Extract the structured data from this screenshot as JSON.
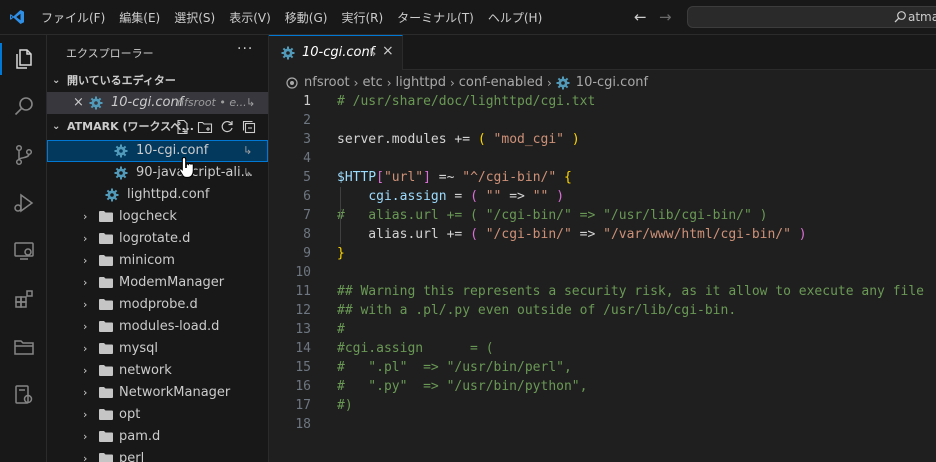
{
  "menubar": {
    "items": [
      "ファイル(F)",
      "編集(E)",
      "選択(S)",
      "表示(V)",
      "移動(G)",
      "実行(R)",
      "ターミナル(T)",
      "ヘルプ(H)"
    ]
  },
  "nav": {
    "back": "←",
    "forward": "→"
  },
  "command_center": {
    "text": "atma"
  },
  "colors": {
    "accent": "#0078d4",
    "selection": "#04395e",
    "gear": "#519aba",
    "folder": "#c5c5c5"
  },
  "sidebar": {
    "title": "エクスプローラー",
    "more": "···",
    "open_editors": {
      "header": "開いているエディター",
      "items": [
        {
          "name": "10-cgi.conf",
          "desc": "nfsroot • e..."
        }
      ]
    },
    "workspace": {
      "header": "ATMARK (ワークスペ...",
      "tree": [
        {
          "name": "10-cgi.conf",
          "type": "conf"
        },
        {
          "name": "90-javascript-ali...",
          "type": "conf"
        },
        {
          "name": "lighttpd.conf",
          "type": "conf"
        },
        {
          "name": "logcheck",
          "type": "folder"
        },
        {
          "name": "logrotate.d",
          "type": "folder"
        },
        {
          "name": "minicom",
          "type": "folder"
        },
        {
          "name": "ModemManager",
          "type": "folder"
        },
        {
          "name": "modprobe.d",
          "type": "folder"
        },
        {
          "name": "modules-load.d",
          "type": "folder"
        },
        {
          "name": "mysql",
          "type": "folder"
        },
        {
          "name": "network",
          "type": "folder"
        },
        {
          "name": "NetworkManager",
          "type": "folder"
        },
        {
          "name": "opt",
          "type": "folder"
        },
        {
          "name": "pam.d",
          "type": "folder"
        },
        {
          "name": "perl",
          "type": "folder"
        }
      ]
    }
  },
  "editor": {
    "tab": {
      "label": "10-cgi.conf",
      "close": "×",
      "link": "↳"
    },
    "breadcrumb": [
      "nfsroot",
      "etc",
      "lighttpd",
      "conf-enabled",
      "10-cgi.conf"
    ],
    "lines": [
      [
        [
          "c-com",
          "# /usr/share/doc/lighttpd/cgi.txt"
        ]
      ],
      [],
      [
        [
          "c-txt",
          "server.modules += "
        ],
        [
          "c-br1",
          "("
        ],
        [
          "c-txt",
          " "
        ],
        [
          "c-str",
          "\"mod_cgi\""
        ],
        [
          "c-txt",
          " "
        ],
        [
          "c-br1",
          ")"
        ]
      ],
      [],
      [
        [
          "c-var",
          "$HTTP"
        ],
        [
          "c-br2",
          "["
        ],
        [
          "c-str",
          "\"url\""
        ],
        [
          "c-br2",
          "]"
        ],
        [
          "c-txt",
          " =~ "
        ],
        [
          "c-str",
          "\"^/cgi-bin/\""
        ],
        [
          "c-txt",
          " "
        ],
        [
          "c-br1",
          "{"
        ]
      ],
      [
        [
          "c-txt",
          "    "
        ],
        [
          "c-var",
          "cgi.assign"
        ],
        [
          "c-txt",
          " = "
        ],
        [
          "c-br2",
          "("
        ],
        [
          "c-txt",
          " "
        ],
        [
          "c-str",
          "\"\""
        ],
        [
          "c-txt",
          " => "
        ],
        [
          "c-str",
          "\"\""
        ],
        [
          "c-txt",
          " "
        ],
        [
          "c-br2",
          ")"
        ]
      ],
      [
        [
          "c-com",
          "#   alias.url += ( \"/cgi-bin/\" => \"/usr/lib/cgi-bin/\" )"
        ]
      ],
      [
        [
          "c-txt",
          "    alias.url += "
        ],
        [
          "c-br2",
          "("
        ],
        [
          "c-txt",
          " "
        ],
        [
          "c-str",
          "\"/cgi-bin/\""
        ],
        [
          "c-txt",
          " => "
        ],
        [
          "c-str",
          "\"/var/www/html/cgi-bin/\""
        ],
        [
          "c-txt",
          " "
        ],
        [
          "c-br2",
          ")"
        ]
      ],
      [
        [
          "c-br1",
          "}"
        ]
      ],
      [],
      [
        [
          "c-com",
          "## Warning this represents a security risk, as it allow to execute any file"
        ]
      ],
      [
        [
          "c-com",
          "## with a .pl/.py even outside of /usr/lib/cgi-bin."
        ]
      ],
      [
        [
          "c-com",
          "#"
        ]
      ],
      [
        [
          "c-com",
          "#cgi.assign      = ("
        ]
      ],
      [
        [
          "c-com",
          "#   \".pl\"  => \"/usr/bin/perl\","
        ]
      ],
      [
        [
          "c-com",
          "#   \".py\"  => \"/usr/bin/python\","
        ]
      ],
      [
        [
          "c-com",
          "#)"
        ]
      ],
      []
    ]
  }
}
